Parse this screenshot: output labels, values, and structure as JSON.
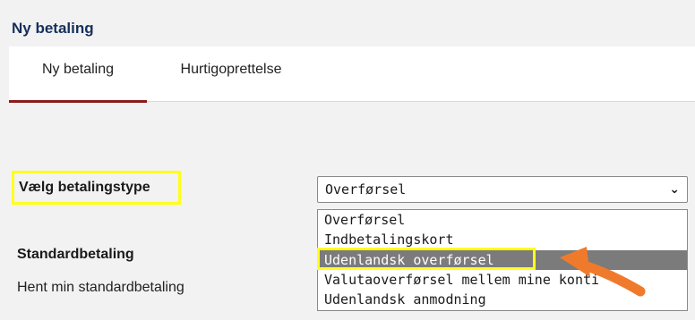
{
  "page_title": "Ny betaling",
  "tabs": [
    {
      "label": "Ny betaling",
      "active": true
    },
    {
      "label": "Hurtigoprettelse",
      "active": false
    }
  ],
  "payment_type": {
    "label": "Vælg betalingstype",
    "selected": "Overførsel",
    "options": [
      "Overførsel",
      "Indbetalingskort",
      "Udenlandsk overførsel",
      "Valutaoverførsel mellem mine konti",
      "Udenlandsk anmodning"
    ],
    "highlighted_option": "Udenlandsk overførsel"
  },
  "standard_payment": {
    "title": "Standardbetaling",
    "link": "Hent min standardbetaling"
  },
  "colors": {
    "title": "#16305b",
    "active_tab_underline": "#8b1a1a",
    "highlight_box": "#ffff1a",
    "selected_option_bg": "#7b7b7b",
    "arrow": "#f07a2b"
  },
  "icons": {
    "select_chevron": "chevron-down-icon",
    "annotation_arrow": "arrow-icon"
  }
}
